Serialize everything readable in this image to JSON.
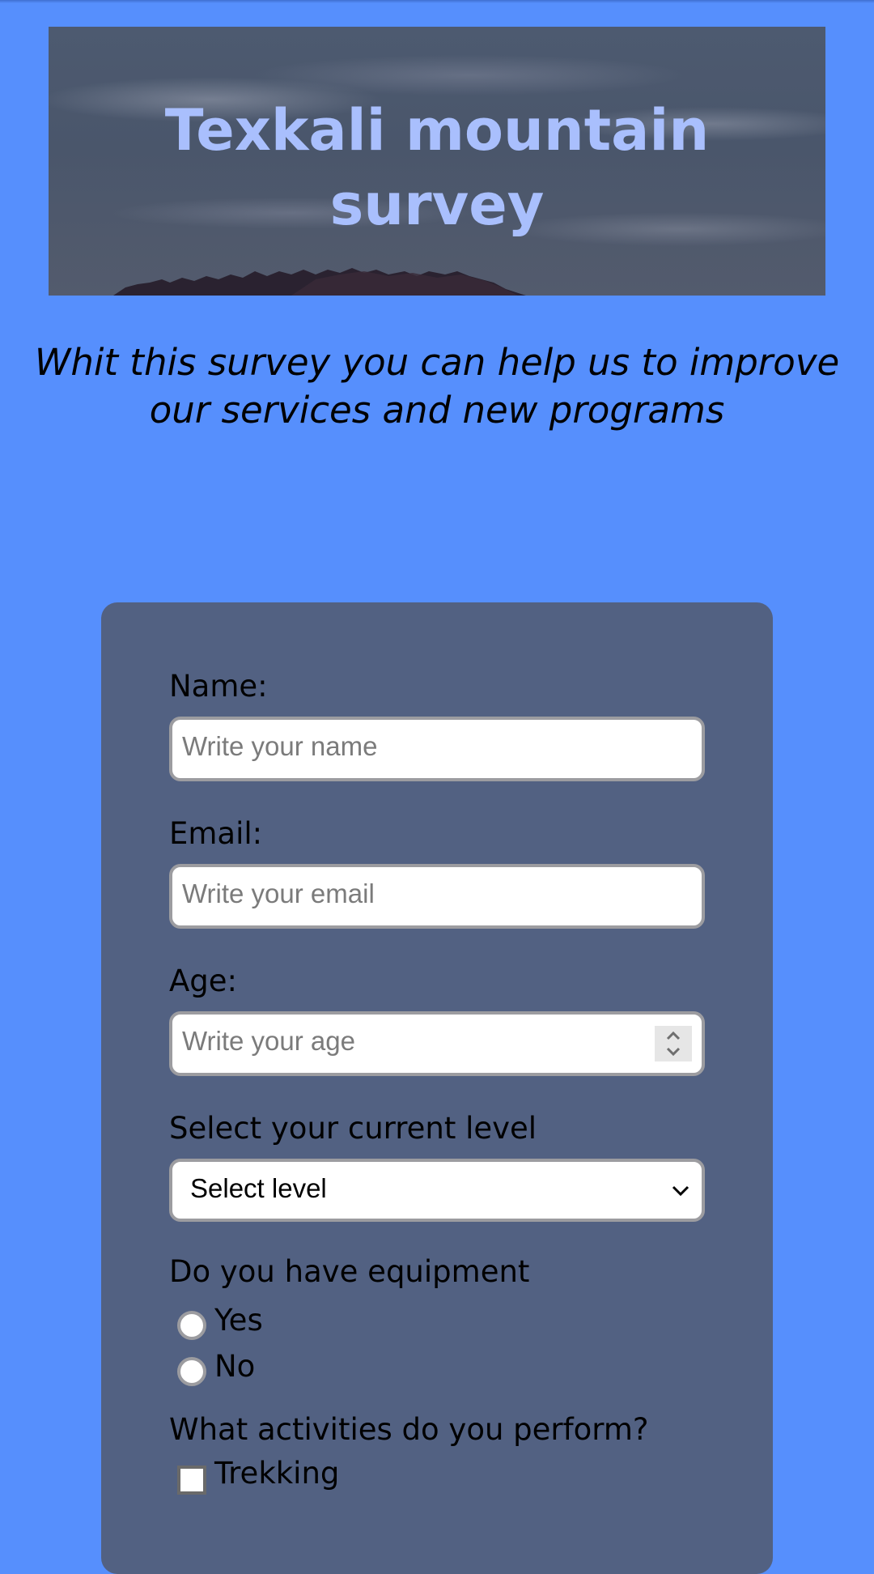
{
  "header": {
    "title": "Texkali mountain survey"
  },
  "subtitle": "Whit this survey you can help us to improve our services and new programs",
  "form": {
    "name": {
      "label": "Name:",
      "placeholder": "Write your name"
    },
    "email": {
      "label": "Email:",
      "placeholder": "Write your email"
    },
    "age": {
      "label": "Age:",
      "placeholder": "Write your age"
    },
    "level": {
      "label": "Select your current level",
      "selected": "Select level"
    },
    "equipment": {
      "label": "Do you have equipment",
      "options": [
        "Yes",
        "No"
      ]
    },
    "activities": {
      "label": "What activities do you perform?",
      "options": [
        "Trekking"
      ]
    }
  },
  "colors": {
    "page_background": "#568ffd",
    "card_background": "#526182",
    "title_color": "#a9bffd"
  }
}
